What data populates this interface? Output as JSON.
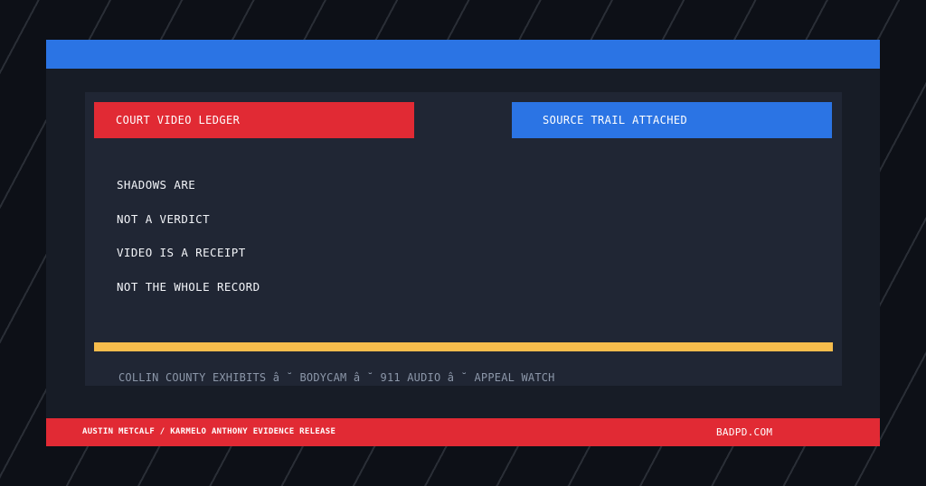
{
  "colors": {
    "background": "#0d1017",
    "frame": "#171c26",
    "panel": "#202634",
    "blue": "#2b74e4",
    "red": "#e12a34",
    "yellow": "#f6bc4c",
    "muted_text": "#8c97a9"
  },
  "panel": {
    "left_tag": "COURT VIDEO LEDGER",
    "right_tag": "SOURCE TRAIL ATTACHED",
    "lines": [
      "SHADOWS ARE",
      "NOT A VERDICT",
      "VIDEO IS A RECEIPT",
      "NOT THE WHOLE RECORD"
    ],
    "footer": "COLLIN COUNTY EXHIBITS â ˘ BODYCAM â ˘ 911 AUDIO â ˘ APPEAL WATCH"
  },
  "bottom_bar": {
    "left_text": "AUSTIN METCALF / KARMELO ANTHONY EVIDENCE RELEASE",
    "right_text": "BADPD.COM"
  }
}
